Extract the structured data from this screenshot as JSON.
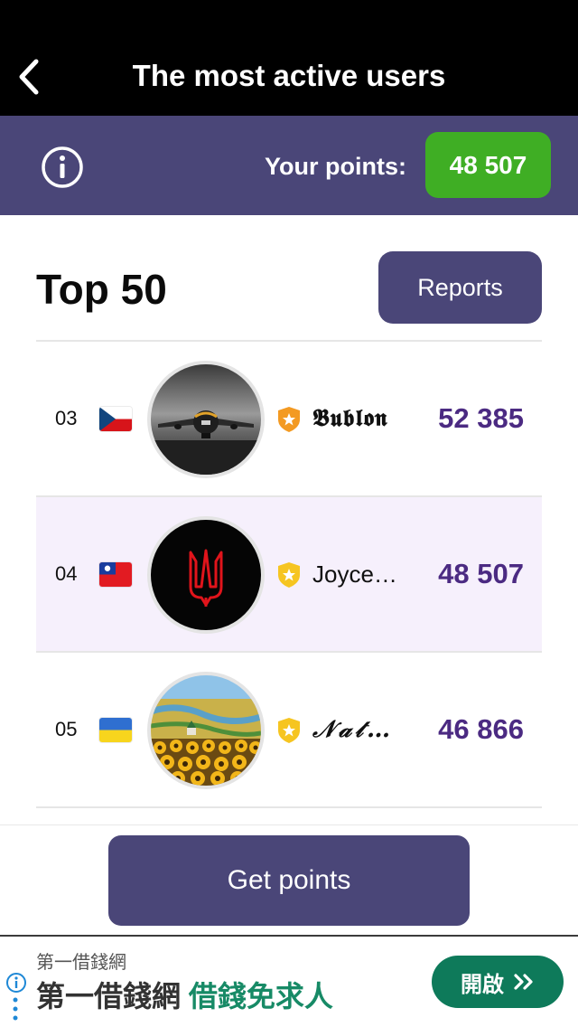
{
  "header": {
    "title": "The most active users",
    "back_icon": "chevron-left-icon"
  },
  "points_bar": {
    "info_icon": "info-icon",
    "label": "Your points:",
    "value": "48 507",
    "badge_color": "#3fae24"
  },
  "leaderboard": {
    "title": "Top 50",
    "reports_label": "Reports",
    "rows": [
      {
        "rank": "03",
        "flag": "czech-flag",
        "avatar": "airplane-photo",
        "badge": "orange-shield-star-icon",
        "name": "𝕭𝖚𝖇𝖑𝖔𝖓",
        "score": "52 385",
        "highlighted": false
      },
      {
        "rank": "04",
        "flag": "taiwan-flag",
        "avatar": "red-trident-emblem",
        "badge": "yellow-shield-star-icon",
        "name": "Joyce…",
        "score": "48 507",
        "highlighted": true
      },
      {
        "rank": "05",
        "flag": "ukraine-flag",
        "avatar": "sunflower-field-painting",
        "badge": "yellow-shield-star-icon",
        "name": "𝒩𝒶𝓉…",
        "score": "46 866",
        "highlighted": false
      }
    ]
  },
  "get_points_label": "Get points",
  "ad": {
    "small_text": "第一借錢網",
    "main_text": "第一借錢網",
    "accent_text": "借錢免求人",
    "button_label": "開啟",
    "button_icon": "double-chevron-right-icon"
  },
  "colors": {
    "accent": "#4a4678",
    "score": "#4b2a82",
    "highlight_row": "#f6f0fc",
    "ad_button": "#0e7a5a"
  }
}
